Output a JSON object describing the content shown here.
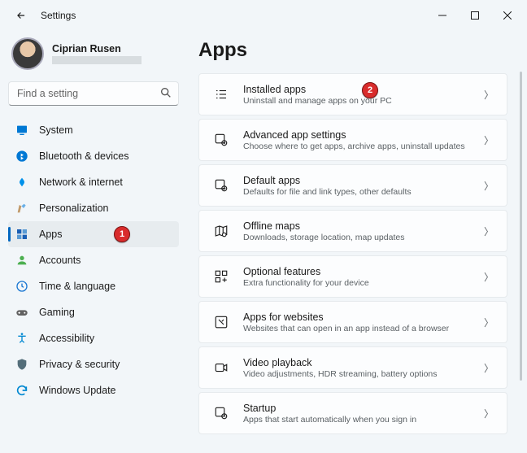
{
  "window": {
    "title": "Settings"
  },
  "user": {
    "name": "Ciprian Rusen"
  },
  "search": {
    "placeholder": "Find a setting"
  },
  "sidebar": {
    "items": [
      {
        "label": "System",
        "icon": "system",
        "color": "#0078d4"
      },
      {
        "label": "Bluetooth & devices",
        "icon": "bluetooth",
        "color": "#0078d4"
      },
      {
        "label": "Network & internet",
        "icon": "network",
        "color": "#0091ea"
      },
      {
        "label": "Personalization",
        "icon": "personal",
        "color": "#c19a6b"
      },
      {
        "label": "Apps",
        "icon": "apps",
        "color": "#1a5fb4",
        "active": true,
        "badge": "1"
      },
      {
        "label": "Accounts",
        "icon": "accounts",
        "color": "#4caf50"
      },
      {
        "label": "Time & language",
        "icon": "time",
        "color": "#1976d2"
      },
      {
        "label": "Gaming",
        "icon": "gaming",
        "color": "#616161"
      },
      {
        "label": "Accessibility",
        "icon": "access",
        "color": "#0288d1"
      },
      {
        "label": "Privacy & security",
        "icon": "privacy",
        "color": "#546e7a"
      },
      {
        "label": "Windows Update",
        "icon": "update",
        "color": "#0288d1"
      }
    ]
  },
  "page": {
    "title": "Apps",
    "cards": [
      {
        "title": "Installed apps",
        "sub": "Uninstall and manage apps on your PC",
        "icon": "installed",
        "badge": "2"
      },
      {
        "title": "Advanced app settings",
        "sub": "Choose where to get apps, archive apps, uninstall updates",
        "icon": "advanced"
      },
      {
        "title": "Default apps",
        "sub": "Defaults for file and link types, other defaults",
        "icon": "defaults"
      },
      {
        "title": "Offline maps",
        "sub": "Downloads, storage location, map updates",
        "icon": "maps"
      },
      {
        "title": "Optional features",
        "sub": "Extra functionality for your device",
        "icon": "optional"
      },
      {
        "title": "Apps for websites",
        "sub": "Websites that can open in an app instead of a browser",
        "icon": "websites"
      },
      {
        "title": "Video playback",
        "sub": "Video adjustments, HDR streaming, battery options",
        "icon": "video"
      },
      {
        "title": "Startup",
        "sub": "Apps that start automatically when you sign in",
        "icon": "startup"
      }
    ]
  }
}
